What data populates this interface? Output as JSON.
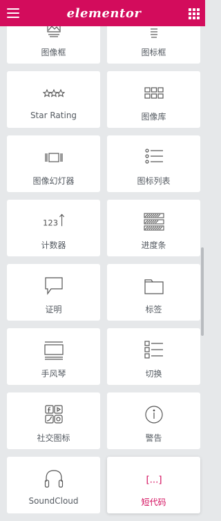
{
  "header": {
    "brand": "elementor",
    "menu_icon": "hamburger-menu-icon",
    "apps_icon": "grid-apps-icon",
    "brand_color": "#d30c5c"
  },
  "widgets": [
    {
      "label": "图像框",
      "icon": "image-box-icon"
    },
    {
      "label": "图标框",
      "icon": "icon-box-icon"
    },
    {
      "label": "Star Rating",
      "icon": "star-rating-icon"
    },
    {
      "label": "图像库",
      "icon": "image-gallery-icon"
    },
    {
      "label": "图像幻灯器",
      "icon": "image-carousel-icon"
    },
    {
      "label": "图标列表",
      "icon": "icon-list-icon"
    },
    {
      "label": "计数器",
      "icon": "counter-icon"
    },
    {
      "label": "进度条",
      "icon": "progress-bar-icon"
    },
    {
      "label": "证明",
      "icon": "testimonial-icon"
    },
    {
      "label": "标签",
      "icon": "tabs-icon"
    },
    {
      "label": "手风琴",
      "icon": "accordion-icon"
    },
    {
      "label": "切换",
      "icon": "toggle-icon"
    },
    {
      "label": "社交图标",
      "icon": "social-icons-icon"
    },
    {
      "label": "警告",
      "icon": "alert-icon"
    },
    {
      "label": "SoundCloud",
      "icon": "soundcloud-icon"
    },
    {
      "label": "短代码",
      "icon": "shortcode-icon"
    }
  ],
  "counter_text": "123",
  "shortcode_text": "[...]",
  "active_widget": "短代码",
  "accent_color": "#d30c5c"
}
